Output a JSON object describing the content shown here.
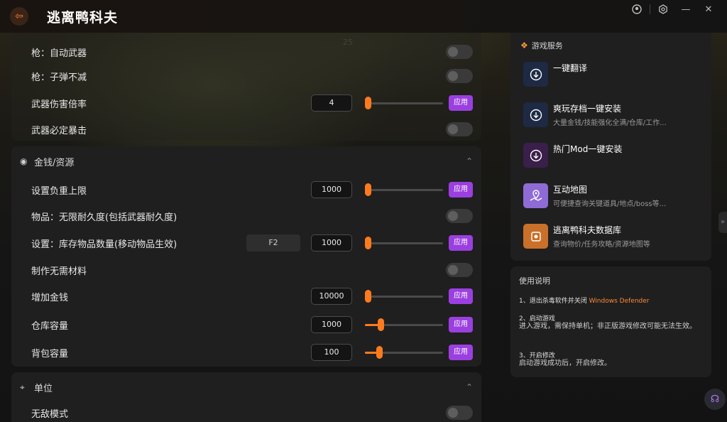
{
  "app": {
    "title": "逃离鸭科夫",
    "back_icon": "back-arrow-icon"
  },
  "titlebar_icons": [
    "user-icon",
    "settings-icon",
    "minimize-icon",
    "close-icon"
  ],
  "background_hud": "25",
  "weapon_section": {
    "rows": [
      {
        "label": "枪：自动武器",
        "type": "toggle"
      },
      {
        "label": "枪：子弹不减",
        "type": "toggle"
      },
      {
        "label": "武器伤害倍率",
        "type": "slider",
        "value": "4",
        "slider_fraction": 0.0,
        "apply": "应用"
      },
      {
        "label": "武器必定暴击",
        "type": "toggle"
      }
    ]
  },
  "money_section": {
    "title": "金钱/资源",
    "rows": [
      {
        "label": "设置负重上限",
        "type": "slider",
        "value": "1000",
        "slider_fraction": 0.0,
        "apply": "应用"
      },
      {
        "label": "物品：无限耐久度(包括武器耐久度)",
        "type": "toggle"
      },
      {
        "label": "设置：库存物品数量(移动物品生效)",
        "type": "slider",
        "hotkey": "F2",
        "value": "1000",
        "slider_fraction": 0.0,
        "apply": "应用"
      },
      {
        "label": "制作无需材料",
        "type": "toggle"
      },
      {
        "label": "增加金钱",
        "type": "slider",
        "value": "10000",
        "slider_fraction": 0.0,
        "apply": "应用"
      },
      {
        "label": "仓库容量",
        "type": "slider",
        "value": "1000",
        "slider_fraction": 0.18,
        "apply": "应用"
      },
      {
        "label": "背包容量",
        "type": "slider",
        "value": "100",
        "slider_fraction": 0.16,
        "apply": "应用"
      }
    ]
  },
  "unit_section": {
    "title": "单位",
    "rows": [
      {
        "label": "无敌模式",
        "type": "toggle"
      }
    ]
  },
  "services": {
    "title": "游戏服务",
    "items": [
      {
        "title": "一键翻译",
        "subtitle": "",
        "icon": "download-icon",
        "color": "#1e2a44"
      },
      {
        "title": "爽玩存档一键安装",
        "subtitle": "大量金钱/技能强化全满/仓库/工作...",
        "icon": "download-icon",
        "color": "#1e2a44"
      },
      {
        "title": "热门Mod一键安装",
        "subtitle": "",
        "icon": "download-icon",
        "color": "#3a1f4a"
      },
      {
        "title": "互动地图",
        "subtitle": "可便捷查询关键道具/地点/boss等...",
        "icon": "map-icon",
        "color": "#8f6bd6"
      },
      {
        "title": "逃离鸭科夫数据库",
        "subtitle": "查询物价/任务攻略/资源地图等",
        "icon": "database-icon",
        "color": "#c9702a"
      }
    ]
  },
  "help": {
    "title": "使用说明",
    "step1": "1、退出杀毒软件并关闭",
    "step1_highlight": "Windows Defender",
    "step2_title": "2、启动游戏",
    "step2_body": "进入游戏，需保持单机；非正版游戏修改可能无法生效。",
    "step3_title": "3、开启修改",
    "step3_body": "启动游戏成功后，开启修改。"
  },
  "colors": {
    "accent_orange": "#ff7a1f",
    "apply_purple": "#9b3fe0",
    "panel": "#1f1f1f"
  }
}
